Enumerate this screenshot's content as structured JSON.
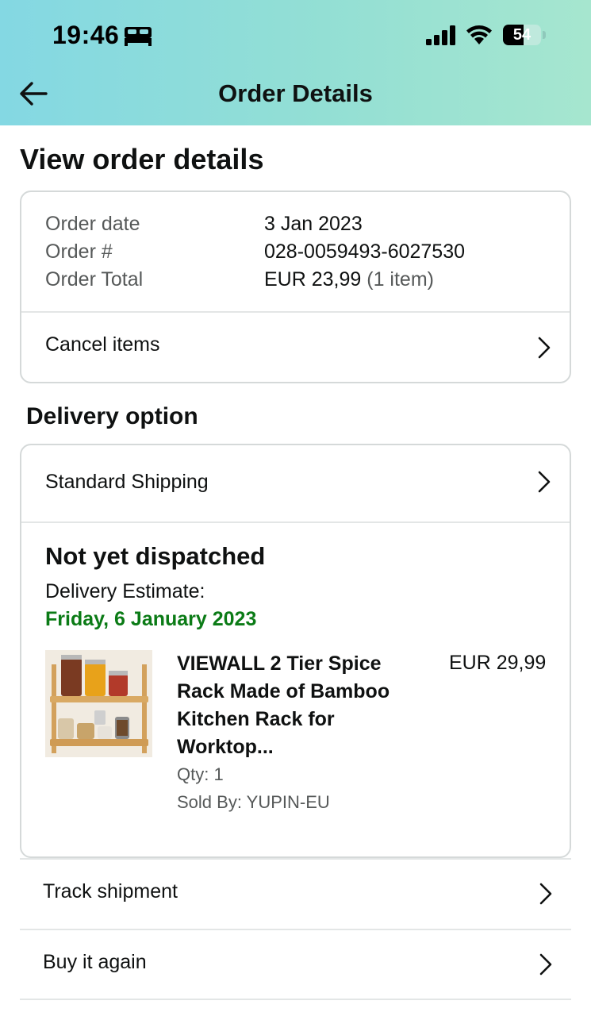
{
  "status_bar": {
    "time": "19:46",
    "battery": "54",
    "icons": [
      "bed-icon",
      "cellular-signal-icon",
      "wifi-icon",
      "battery-icon"
    ]
  },
  "header": {
    "title": "Order Details",
    "back_icon": "arrow-left-icon",
    "gradient_colors": [
      "#84d8e3",
      "#a6e6cf"
    ]
  },
  "page": {
    "heading": "View order details"
  },
  "order_summary": {
    "rows": [
      {
        "label": "Order date",
        "value": "3 Jan 2023"
      },
      {
        "label": "Order #",
        "value": "028-0059493-6027530"
      },
      {
        "label": "Order Total",
        "value": "EUR 23,99",
        "note": "(1 item)"
      }
    ],
    "cancel_label": "Cancel items"
  },
  "delivery": {
    "heading": "Delivery option",
    "shipping_method": "Standard Shipping",
    "status": "Not yet dispatched",
    "estimate_label": "Delivery Estimate:",
    "estimate_date": "Friday, 6 January 2023",
    "estimate_color": "#0b7b16",
    "item": {
      "title": "VIEWALL 2 Tier Spice Rack Made of Bamboo Kitchen Rack for Worktop...",
      "price": "EUR 29,99",
      "qty": "Qty: 1",
      "seller": "Sold By: YUPIN-EU",
      "image": "spice-rack-product-image"
    }
  },
  "actions": [
    {
      "label": "Track shipment"
    },
    {
      "label": "Buy it again"
    }
  ]
}
